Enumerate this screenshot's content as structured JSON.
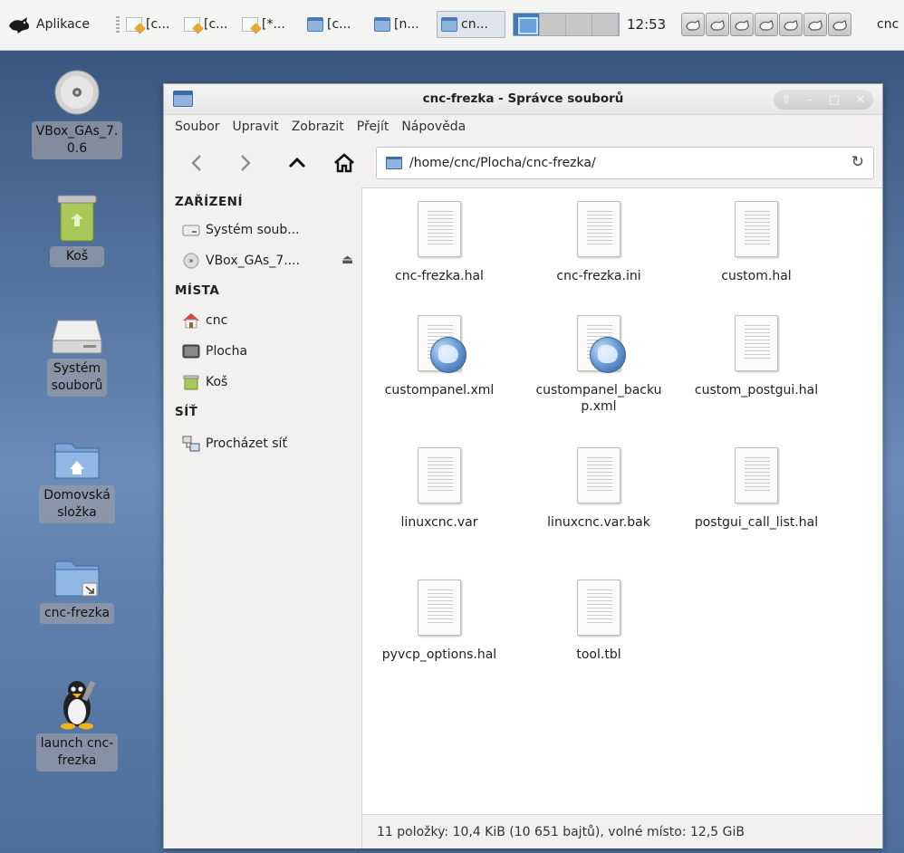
{
  "panel": {
    "apps_label": "Aplikace",
    "tasks": [
      {
        "label": "[c...",
        "type": "doc"
      },
      {
        "label": "[c...",
        "type": "doc"
      },
      {
        "label": "[*...",
        "type": "doc"
      },
      {
        "label": "[c...",
        "type": "folder"
      },
      {
        "label": "[n...",
        "type": "folder"
      },
      {
        "label": "cn...",
        "type": "folder",
        "active": true
      }
    ],
    "clock": "12:53",
    "user": "cnc",
    "network_icon_count": 7
  },
  "desktop": {
    "icons": [
      {
        "label": "VBox_GAs_7.\n0.6",
        "icon": "cdrom-icon"
      },
      {
        "label": "Koš",
        "icon": "trash-icon"
      },
      {
        "label": "Systém\nsouborů",
        "icon": "harddisk-icon"
      },
      {
        "label": "Domovská\nsložka",
        "icon": "home-folder-icon"
      },
      {
        "label": "cnc-frezka",
        "icon": "folder-link-icon"
      },
      {
        "label": "launch cnc-\nfrezka",
        "icon": "tux-icon"
      }
    ]
  },
  "window": {
    "title": "cnc-frezka - Správce souborů",
    "menu": [
      "Soubor",
      "Upravit",
      "Zobrazit",
      "Přejít",
      "Nápověda"
    ],
    "path": "/home/cnc/Plocha/cnc-frezka/",
    "sidebar": {
      "devices_heading": "ZAŘÍZENÍ",
      "devices": [
        {
          "label": "Systém soub...",
          "icon": "harddisk-icon"
        },
        {
          "label": "VBox_GAs_7....",
          "icon": "cdrom-icon",
          "ejectable": true
        }
      ],
      "places_heading": "MÍSTA",
      "places": [
        {
          "label": "cnc",
          "icon": "home-icon"
        },
        {
          "label": "Plocha",
          "icon": "desktop-icon"
        },
        {
          "label": "Koš",
          "icon": "trash-icon"
        }
      ],
      "network_heading": "SÍŤ",
      "network": [
        {
          "label": "Procházet síť",
          "icon": "network-icon"
        }
      ]
    },
    "files": [
      {
        "name": "cnc-frezka.hal",
        "kind": "text"
      },
      {
        "name": "cnc-frezka.ini",
        "kind": "text"
      },
      {
        "name": "custom.hal",
        "kind": "text"
      },
      {
        "name": "custompanel.xml",
        "kind": "xml"
      },
      {
        "name": "custompanel_backup.xml",
        "kind": "xml"
      },
      {
        "name": "custom_postgui.hal",
        "kind": "text"
      },
      {
        "name": "linuxcnc.var",
        "kind": "text"
      },
      {
        "name": "linuxcnc.var.bak",
        "kind": "text"
      },
      {
        "name": "postgui_call_list.hal",
        "kind": "text"
      },
      {
        "name": "pyvcp_options.hal",
        "kind": "text"
      },
      {
        "name": "tool.tbl",
        "kind": "text"
      }
    ],
    "status": "11 položky: 10,4 KiB (10 651 bajtů), volné místo: 12,5 GiB"
  }
}
